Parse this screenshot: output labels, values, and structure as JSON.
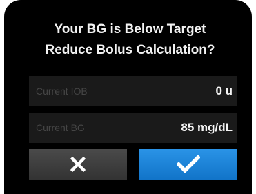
{
  "dialog": {
    "title_line1": "Your BG is Below Target",
    "title_line2": "Reduce Bolus Calculation?"
  },
  "info": [
    {
      "label": "Current IOB",
      "value": "0 u"
    },
    {
      "label": "Current BG",
      "value": "85 mg/dL"
    }
  ],
  "buttons": {
    "cancel_icon": "x-icon",
    "confirm_icon": "checkmark-icon"
  },
  "colors": {
    "confirm_button": "#1a82d8",
    "cancel_button": "#3c3c3c",
    "row_background": "#1a1a1a"
  }
}
